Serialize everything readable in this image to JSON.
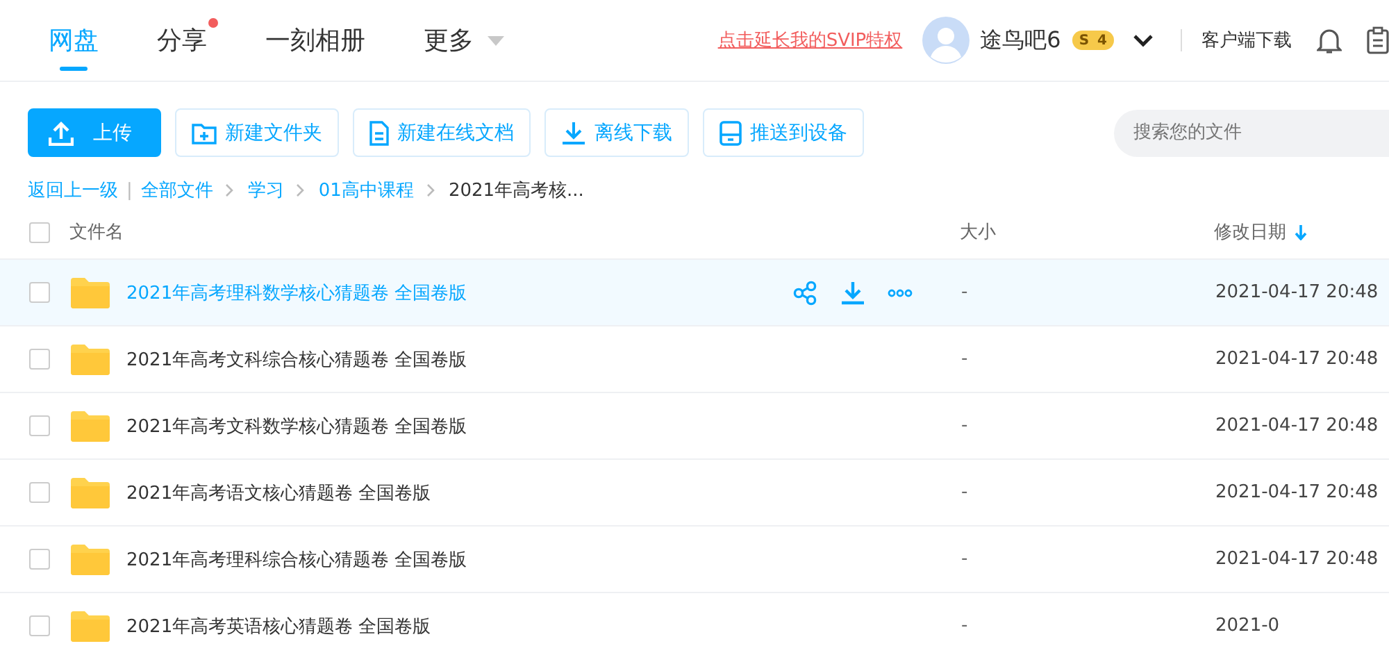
{
  "nav": {
    "tabs": [
      {
        "label": "网盘",
        "selected": true,
        "dot": false,
        "caret": false
      },
      {
        "label": "分享",
        "selected": false,
        "dot": true,
        "caret": false
      },
      {
        "label": "一刻相册",
        "selected": false,
        "dot": false,
        "caret": false
      },
      {
        "label": "更多",
        "selected": false,
        "dot": false,
        "caret": true
      }
    ],
    "svip_link": "点击延长我的SVIP特权",
    "username": "途鸟吧6",
    "vip_badge": {
      "s": "S",
      "level": "4"
    },
    "client_download": "客户端下载"
  },
  "toolbar": {
    "buttons": [
      {
        "label": "上传",
        "kind": "upload"
      },
      {
        "label": "新建文件夹",
        "kind": "folder"
      },
      {
        "label": "新建在线文档",
        "kind": "doc"
      },
      {
        "label": "离线下载",
        "kind": "download"
      },
      {
        "label": "推送到设备",
        "kind": "device"
      }
    ],
    "search": {
      "placeholder": "搜索您的文件"
    }
  },
  "breadcrumb": {
    "back": "返回上一级",
    "separator": "|",
    "items": [
      "全部文件",
      "学习",
      "01高中课程"
    ],
    "current": "2021年高考核..."
  },
  "table": {
    "select_all_checked": false,
    "columns": [
      "文件名",
      "大小",
      "修改日期"
    ],
    "rows": [
      {
        "name": "2021年高考理科数学核心猜题卷 全国卷版",
        "size": "-",
        "date": "2021-04-17 20:48",
        "hovered": true,
        "checked": false
      },
      {
        "name": "2021年高考文科综合核心猜题卷 全国卷版",
        "size": "-",
        "date": "2021-04-17 20:48",
        "hovered": false,
        "checked": false
      },
      {
        "name": "2021年高考文科数学核心猜题卷 全国卷版",
        "size": "-",
        "date": "2021-04-17 20:48",
        "hovered": false,
        "checked": false
      },
      {
        "name": "2021年高考语文核心猜题卷 全国卷版",
        "size": "-",
        "date": "2021-04-17 20:48",
        "hovered": false,
        "checked": false
      },
      {
        "name": "2021年高考理科综合核心猜题卷 全国卷版",
        "size": "-",
        "date": "2021-04-17 20:48",
        "hovered": false,
        "checked": false
      },
      {
        "name": "2021年高考英语核心猜题卷 全国卷版",
        "size": "-",
        "date": "2021-0",
        "hovered": false,
        "checked": false
      }
    ]
  }
}
